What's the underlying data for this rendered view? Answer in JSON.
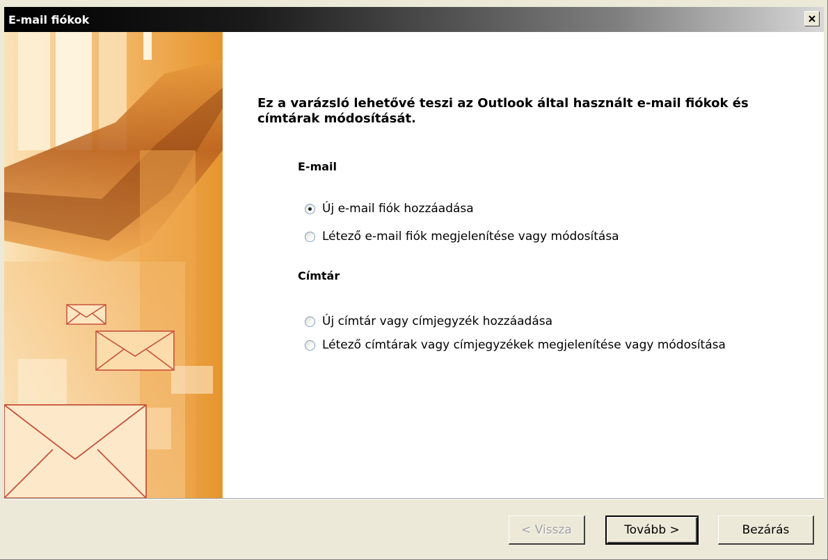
{
  "window": {
    "title": "E-mail fiókok"
  },
  "heading": "Ez a varázsló lehetővé teszi az Outlook által használt e-mail fiókok és címtárak módosítását.",
  "email_section": {
    "title": "E-mail",
    "options": [
      {
        "label": "Új e-mail fiók hozzáadása",
        "checked": true
      },
      {
        "label": "Létező e-mail fiók megjelenítése vagy módosítása",
        "checked": false
      }
    ]
  },
  "directory_section": {
    "title": "Címtár",
    "options": [
      {
        "label": "Új címtár vagy címjegyzék hozzáadása",
        "checked": false
      },
      {
        "label": "Létező címtárak vagy címjegyzékek megjelenítése vagy módosítása",
        "checked": false
      }
    ]
  },
  "buttons": {
    "back": "< Vissza",
    "next": "Tovább >",
    "close": "Bezárás"
  },
  "icons": {
    "close": "close-icon",
    "banner": "envelope-banner"
  },
  "colors": {
    "banner_orange": "#e8962e",
    "banner_light": "#fbe6bf",
    "envelope_stroke": "#c0392b"
  }
}
